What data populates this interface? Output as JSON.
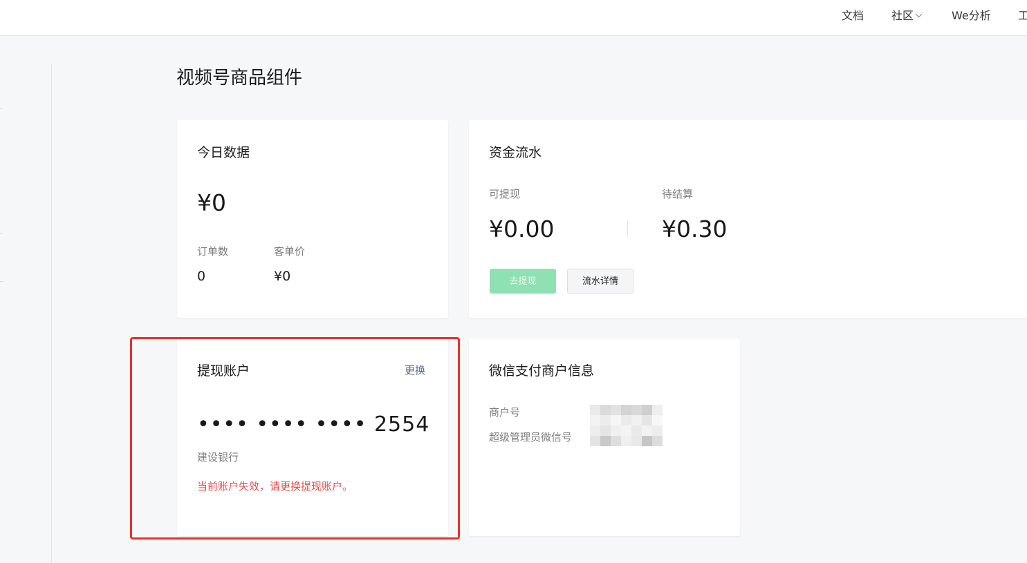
{
  "header": {
    "nav": [
      {
        "label": "文档"
      },
      {
        "label": "社区",
        "has_dropdown": true
      },
      {
        "label": "We分析"
      },
      {
        "label": "工"
      }
    ]
  },
  "page": {
    "title": "视频号商品组件"
  },
  "today_data": {
    "title": "今日数据",
    "amount": "¥0",
    "orders_label": "订单数",
    "orders_value": "0",
    "avg_price_label": "客单价",
    "avg_price_value": "¥0"
  },
  "fund_flow": {
    "title": "资金流水",
    "withdrawable_label": "可提现",
    "withdrawable_value": "¥0.00",
    "pending_label": "待结算",
    "pending_value": "¥0.30",
    "withdraw_button": "去提现",
    "detail_button": "流水详情"
  },
  "withdraw_account": {
    "title": "提现账户",
    "change_link": "更换",
    "masked_number": "•••• •••• •••• 2554",
    "bank_name": "建设银行",
    "error_message": "当前账户失效，请更换提现账户。"
  },
  "merchant_info": {
    "title": "微信支付商户信息",
    "merchant_id_label": "商户号",
    "admin_wechat_label": "超级管理员微信号"
  },
  "colors": {
    "accent_green": "#07c160",
    "link_blue": "#576b95",
    "error_red": "#e74c4c",
    "highlight_red": "#e8302a"
  }
}
